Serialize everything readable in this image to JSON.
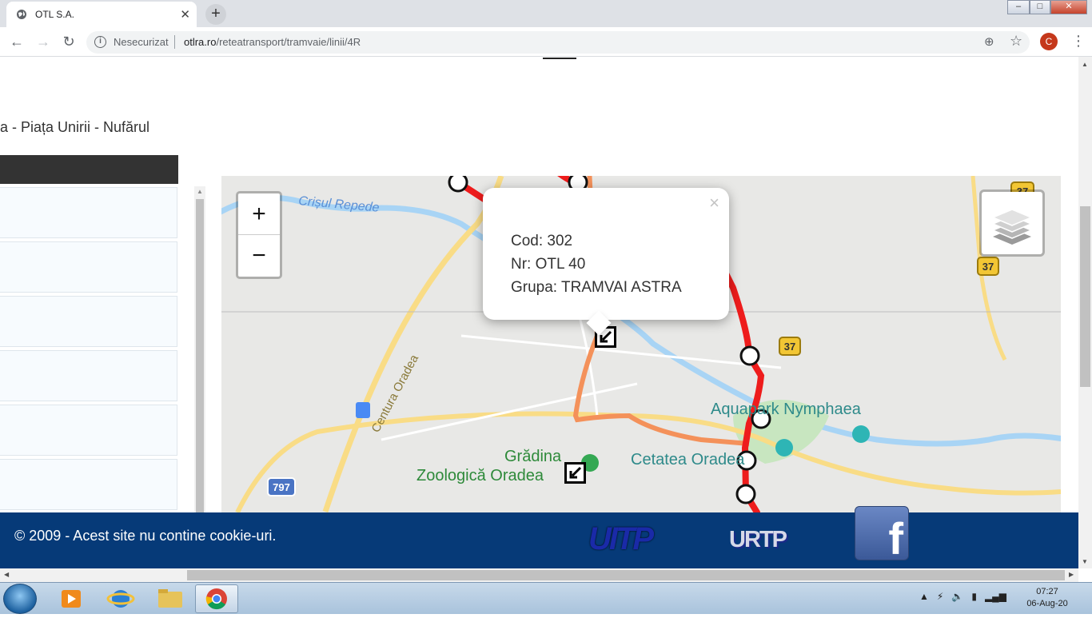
{
  "browser": {
    "tab_title": "OTL S.A.",
    "tab_close": "✕",
    "new_tab": "+",
    "security_label": "Nesecurizat",
    "url_host": "otlra.ro",
    "url_path": "/reteatransport/tramvaie/linii/4R",
    "profile_initial": "C",
    "window_buttons": [
      "–",
      "□",
      "✕"
    ]
  },
  "page": {
    "route_title": "a - Piața Unirii - Nufărul"
  },
  "map": {
    "zoom_in": "+",
    "zoom_out": "−",
    "popup": {
      "close": "×",
      "cod_label": "Cod: 302",
      "nr_label": "Nr: OTL 40",
      "grupa_label": "Grupa: TRAMVAI ASTRA"
    },
    "labels": {
      "river": "Crișul Repede",
      "ring_road": "Centura Oradea",
      "aquapark": "Aquapark Nymphaea",
      "zoo_line1": "Grădina",
      "zoo_line2": "Zoologică Oradea",
      "citadel": "Cetatea Oradea",
      "road_37_a": "37",
      "road_37_b": "37",
      "road_37_c": "37",
      "road_797": "797"
    },
    "colors": {
      "route_red": "#ee1c1c",
      "route_orange": "#f4915a",
      "road_yellow": "#f9dc86",
      "water": "#a8d4f5",
      "park": "#c8e6c0"
    }
  },
  "footer": {
    "copyright": "© 2009 - Acest site nu contine cookie-uri.",
    "uitp": "UITP",
    "urtp": "URTP",
    "facebook": "f"
  },
  "taskbar": {
    "time": "07:27",
    "date": "06-Aug-20"
  }
}
